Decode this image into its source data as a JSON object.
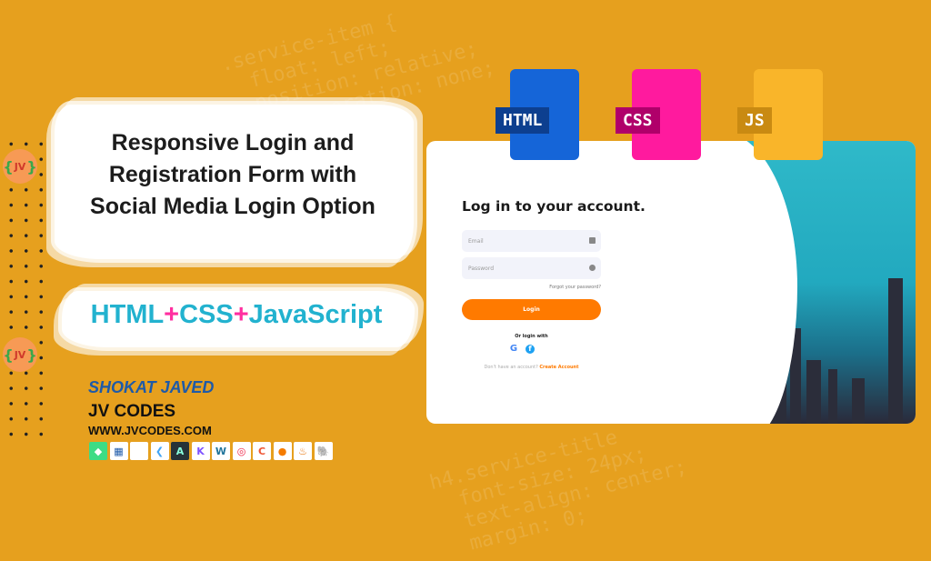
{
  "headline": {
    "line1": "Responsive Login and",
    "line2": "Registration Form with",
    "line3": "Social Media Login Option"
  },
  "tech": {
    "part1": "HTML",
    "plus1": "+",
    "part2": "CSS",
    "plus2": "+",
    "part3": "JavaScript"
  },
  "files": [
    {
      "label": "HTML",
      "color": "#1565D8"
    },
    {
      "label": "CSS",
      "color": "#FF1A9E"
    },
    {
      "label": "JS",
      "color": "#F9B52A"
    }
  ],
  "logo": {
    "text": "JV"
  },
  "author": {
    "name": "SHOKAT JAVED",
    "brand": "JV CODES",
    "site": "WWW.JVCODES.COM"
  },
  "tech_icons": [
    "android-icon",
    "microsoft-store-icon",
    "apple-icon",
    "flutter-icon",
    "android-studio-icon",
    "kotlin-icon",
    "wordpress-icon",
    "airtable-icon",
    "google-ads-icon",
    "firebase-icon",
    "java-icon",
    "postgresql-icon"
  ],
  "form": {
    "title": "Log in to your account.",
    "email_placeholder": "Email",
    "password_placeholder": "Password",
    "forgot": "Forgot your password?",
    "login": "Login",
    "or": "Or login with",
    "no_account": "Don't have an account?",
    "create": "Create Account"
  },
  "colors": {
    "background": "#E6A01E",
    "accent": "#FF7A00",
    "tech_text": "#22B2CF",
    "author": "#1E5AA8"
  }
}
